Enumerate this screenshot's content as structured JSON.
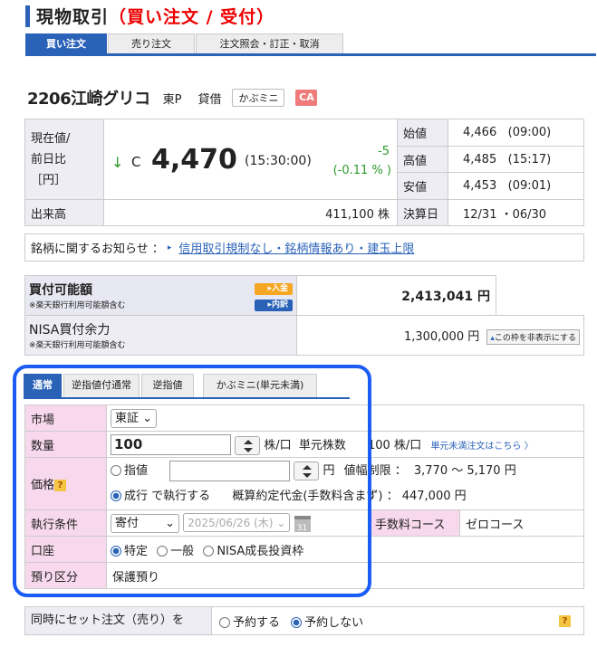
{
  "page": {
    "title_main": "現物取引",
    "title_sub": "（買い注文 / 受付）"
  },
  "main_tabs": [
    "買い注文",
    "売り注文",
    "注文照会・訂正・取消"
  ],
  "stock": {
    "name": "2206江崎グリコ",
    "market": "東P",
    "loan": "貸借",
    "kabumini": "かぶミニ",
    "ca_badge": "CA"
  },
  "quote": {
    "price_label_1": "現在値/",
    "price_label_2": "前日比",
    "price_label_3": "［円］",
    "arrow": "↓",
    "flag": "C",
    "price": "4,470",
    "time": "(15:30:00)",
    "change": "-5",
    "change_pct": "(-0.11 % )",
    "open_label": "始値",
    "open": "4,466",
    "open_time": "(09:00)",
    "high_label": "高値",
    "high": "4,485",
    "high_time": "(15:17)",
    "low_label": "安値",
    "low": "4,453",
    "low_time": "(09:01)",
    "volume_label": "出来高",
    "volume": "411,100 株",
    "settle_label": "決算日",
    "settle": "12/31 ・06/30"
  },
  "notice": {
    "label": "銘柄に関するお知らせ ：",
    "link": "信用取引規制なし・銘柄情報あり・建玉上限"
  },
  "balance": {
    "buy_label": "買付可能額",
    "buy_note": "※楽天銀行利用可能額含む",
    "buy_amount": "2,413,041 円",
    "deposit_btn": "入金",
    "detail_btn": "内訳",
    "nisa_label": "NISA買付余力",
    "nisa_note": "※楽天銀行利用可能額含む",
    "nisa_amount": "1,300,000 円",
    "hide_btn": "この枠を非表示にする"
  },
  "order_tabs": [
    "通常",
    "逆指値付通常",
    "逆指値",
    "かぶミニ(単元未満)"
  ],
  "form": {
    "market_label": "市場",
    "market_value": "東証",
    "qty_label": "数量",
    "qty_value": "100",
    "qty_unit": "株/口",
    "unit_label": "単元株数",
    "unit_value": "100 株/口",
    "odd_lot_link": "単元未満注文はこちら 〉",
    "price_label": "価格",
    "limit_label": "指値",
    "limit_value": "",
    "yen": "円",
    "range_label": "値幅制限 ：",
    "range_value": "3,770 ～ 5,170 円",
    "market_order_label": "成行",
    "exec_text": "で執行する",
    "est_label": "概算約定代金(手数料含まず) ：",
    "est_value": "447,000 円",
    "cond_label": "執行条件",
    "cond_value": "寄付",
    "date_value": "2025/06/26 (木)",
    "cal": "31",
    "fee_label": "手数料コース",
    "fee_value": "ゼロコース",
    "account_label": "口座",
    "acc_1": "特定",
    "acc_2": "一般",
    "acc_3": "NISA成長投資枠",
    "custody_label": "預り区分",
    "custody_value": "保護預り"
  },
  "set_order": {
    "label": "同時にセット注文（売り）を",
    "opt_yes": "予約する",
    "opt_no": "予約しない"
  }
}
